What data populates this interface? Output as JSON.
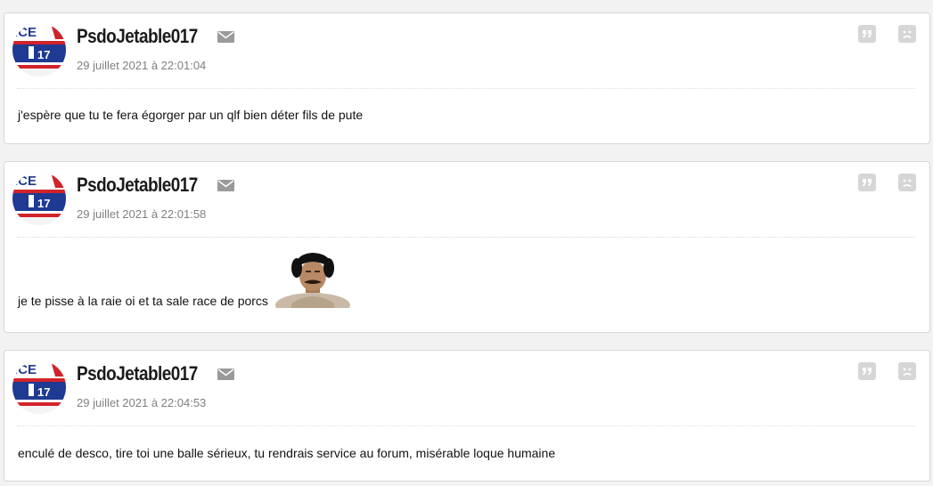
{
  "posts": [
    {
      "author": "PsdoJetable017",
      "date": "29 juillet 2021 à 22:01:04",
      "text": "j'espère que tu te fera égorger par un qlf bien déter fils de pute",
      "avatar_text_top": "ICE",
      "avatar_text_num": "17"
    },
    {
      "author": "PsdoJetable017",
      "date": "29 juillet 2021 à 22:01:58",
      "text": "je te pisse à la raie oi et ta sale race de porcs",
      "avatar_text_top": "ICE",
      "avatar_text_num": "17",
      "sticker": "sticker-image"
    },
    {
      "author": "PsdoJetable017",
      "date": "29 juillet 2021 à 22:04:53",
      "text": "enculé de desco, tire toi une balle sérieux, tu rendrais service au forum, misérable loque humaine",
      "avatar_text_top": "ICE",
      "avatar_text_num": "17"
    }
  ],
  "icons": {
    "mail": "envelope-icon",
    "quote": "quote-icon",
    "alert": "sad-face-report-icon"
  },
  "colors": {
    "page_bg": "#f2f2f2",
    "card_bg": "#ffffff",
    "avatar_blue": "#1f3a93",
    "avatar_red": "#d2232a",
    "icon_gray": "#d6d6d6"
  }
}
